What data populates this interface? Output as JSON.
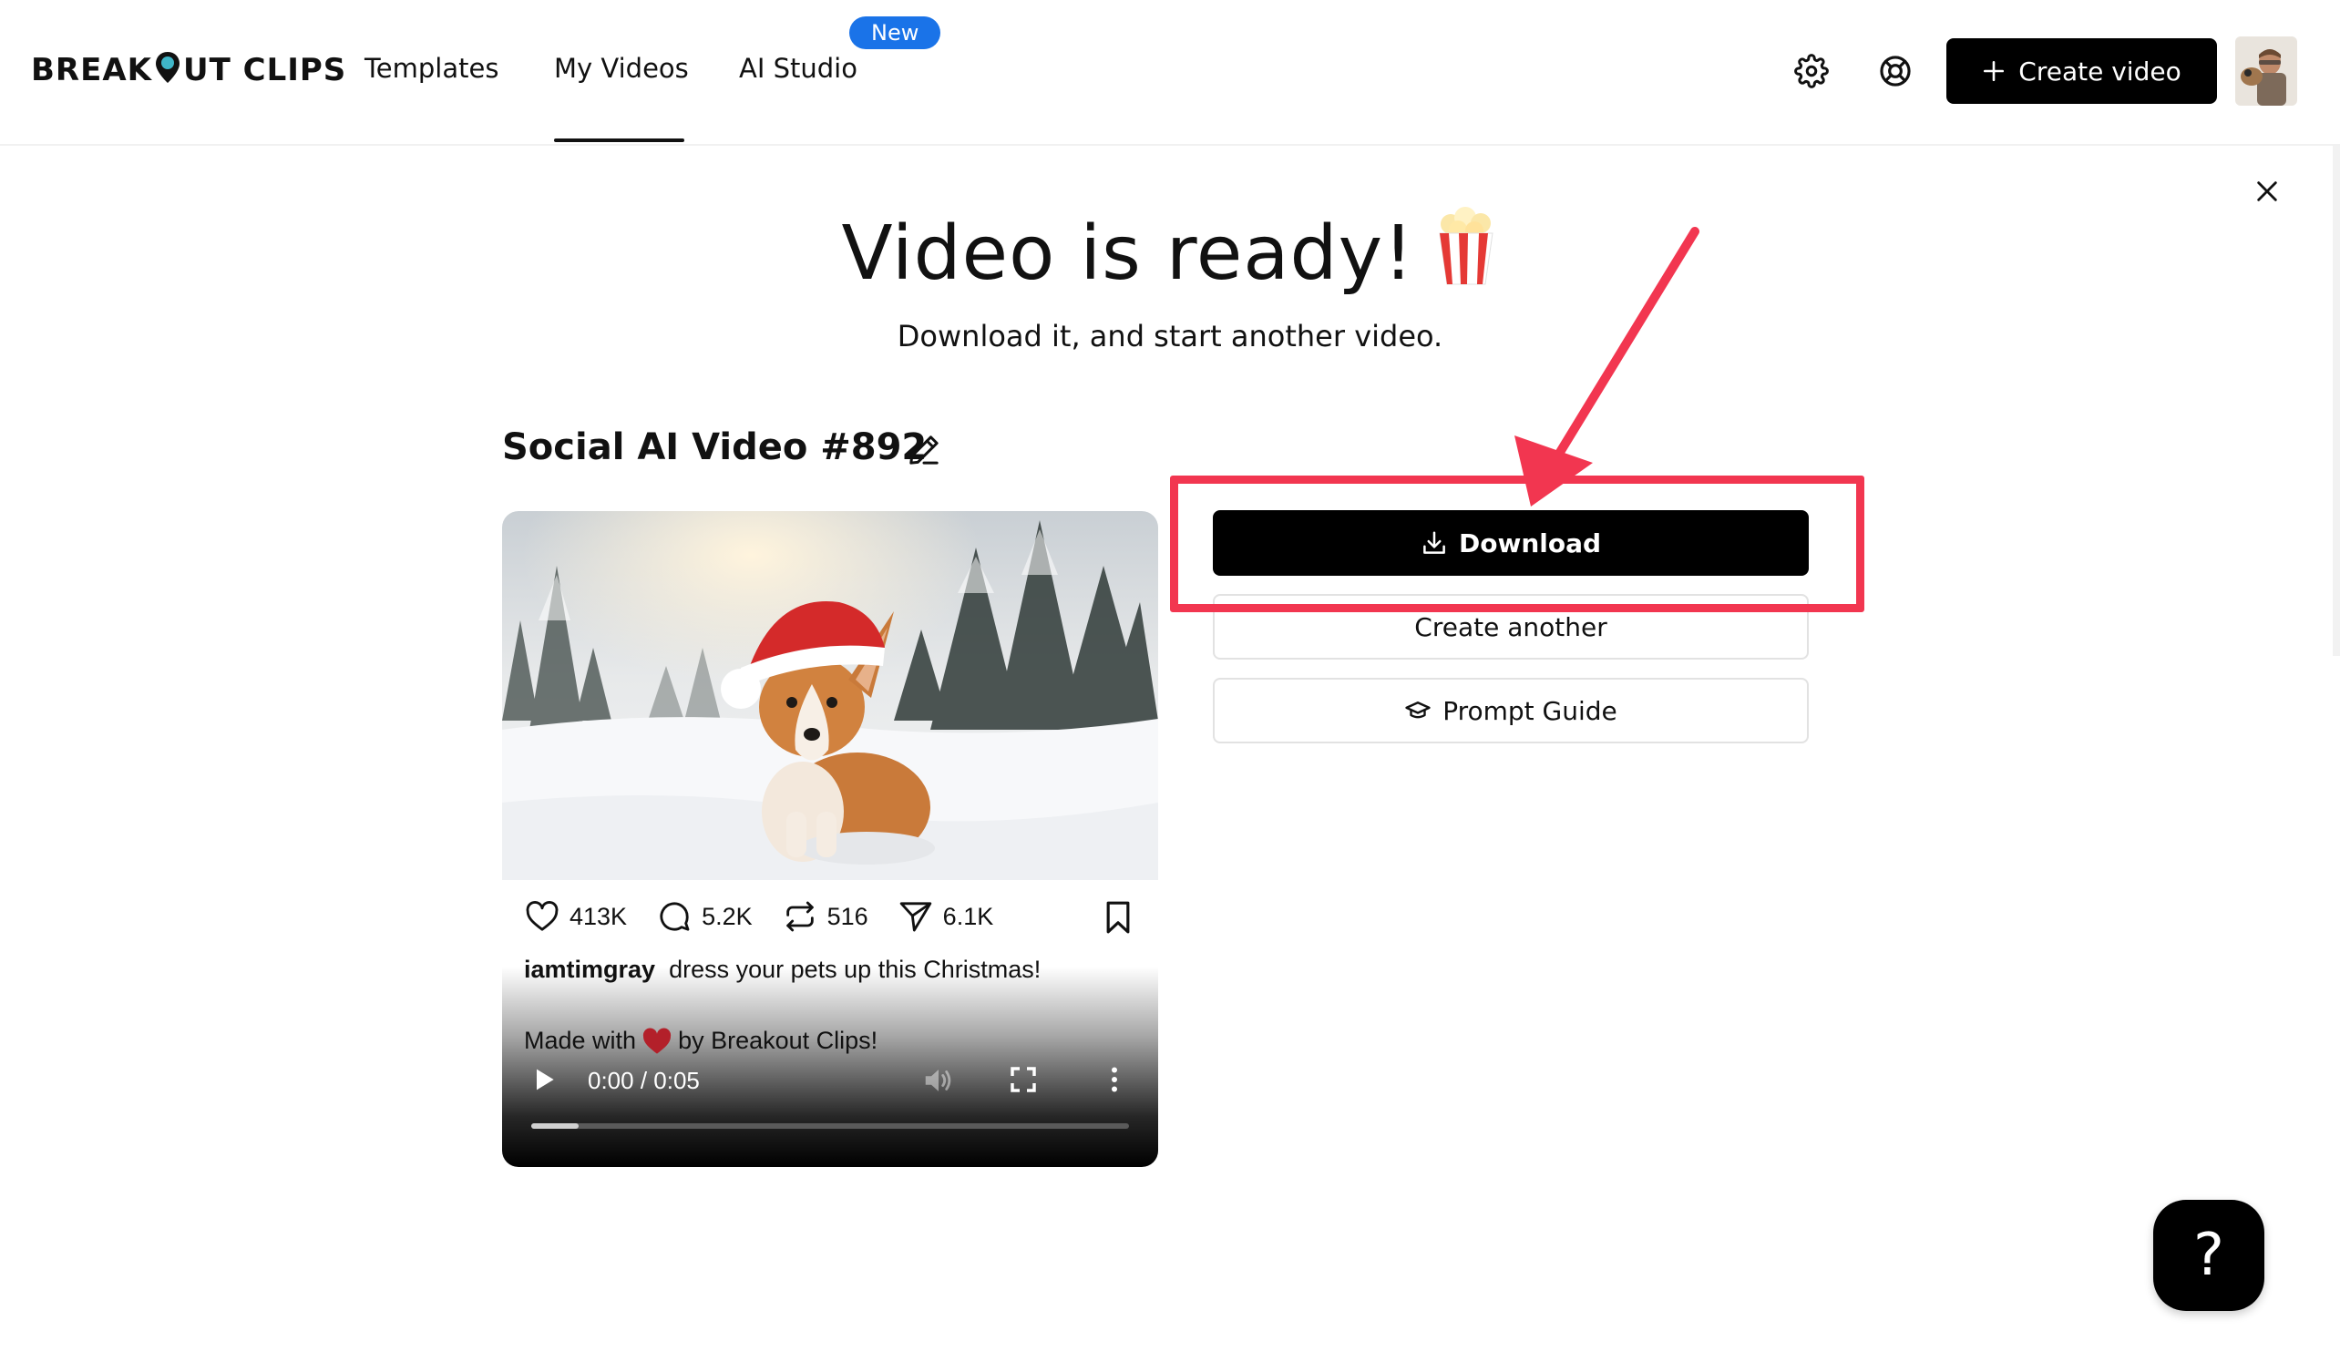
{
  "header": {
    "logo_left": "BREAK",
    "logo_right": "UT CLIPS",
    "nav": {
      "templates": "Templates",
      "my_videos": "My Videos",
      "ai_studio": "AI Studio"
    },
    "new_badge": "New",
    "create_button": "Create video"
  },
  "headline": {
    "title": "Video is ready!",
    "subtitle": "Download it, and start another video."
  },
  "video": {
    "title": "Social AI Video #892",
    "stats": {
      "likes": "413K",
      "comments": "5.2K",
      "reposts": "516",
      "shares": "6.1K"
    },
    "caption_user": "iamtimgray",
    "caption_text": "dress your pets up this Christmas!",
    "made_with_prefix": "Made with",
    "made_with_suffix": "by Breakout Clips!",
    "time": "0:00 / 0:05",
    "progress": 0.08
  },
  "actions": {
    "download": "Download",
    "create_another": "Create another",
    "prompt_guide": "Prompt Guide"
  },
  "help": "?",
  "colors": {
    "accent_blue": "#1a73e8",
    "annotation_red": "#f23650",
    "primary_black": "#000000"
  }
}
